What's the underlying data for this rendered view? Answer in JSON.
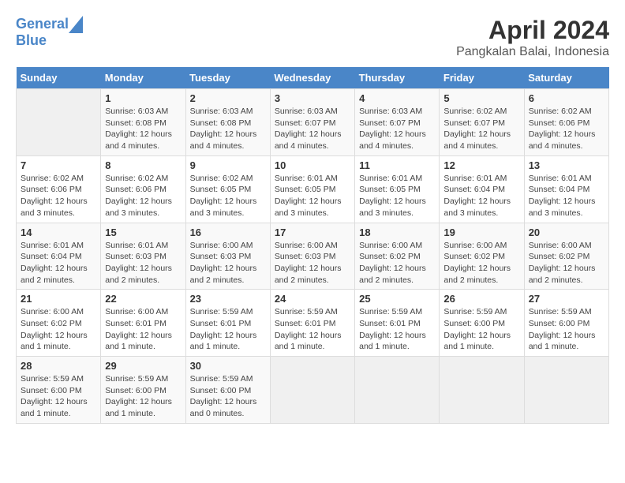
{
  "header": {
    "logo_line1": "General",
    "logo_line2": "Blue",
    "title": "April 2024",
    "subtitle": "Pangkalan Balai, Indonesia"
  },
  "weekdays": [
    "Sunday",
    "Monday",
    "Tuesday",
    "Wednesday",
    "Thursday",
    "Friday",
    "Saturday"
  ],
  "weeks": [
    [
      {
        "day": "",
        "info": ""
      },
      {
        "day": "1",
        "info": "Sunrise: 6:03 AM\nSunset: 6:08 PM\nDaylight: 12 hours\nand 4 minutes."
      },
      {
        "day": "2",
        "info": "Sunrise: 6:03 AM\nSunset: 6:08 PM\nDaylight: 12 hours\nand 4 minutes."
      },
      {
        "day": "3",
        "info": "Sunrise: 6:03 AM\nSunset: 6:07 PM\nDaylight: 12 hours\nand 4 minutes."
      },
      {
        "day": "4",
        "info": "Sunrise: 6:03 AM\nSunset: 6:07 PM\nDaylight: 12 hours\nand 4 minutes."
      },
      {
        "day": "5",
        "info": "Sunrise: 6:02 AM\nSunset: 6:07 PM\nDaylight: 12 hours\nand 4 minutes."
      },
      {
        "day": "6",
        "info": "Sunrise: 6:02 AM\nSunset: 6:06 PM\nDaylight: 12 hours\nand 4 minutes."
      }
    ],
    [
      {
        "day": "7",
        "info": "Sunrise: 6:02 AM\nSunset: 6:06 PM\nDaylight: 12 hours\nand 3 minutes."
      },
      {
        "day": "8",
        "info": "Sunrise: 6:02 AM\nSunset: 6:06 PM\nDaylight: 12 hours\nand 3 minutes."
      },
      {
        "day": "9",
        "info": "Sunrise: 6:02 AM\nSunset: 6:05 PM\nDaylight: 12 hours\nand 3 minutes."
      },
      {
        "day": "10",
        "info": "Sunrise: 6:01 AM\nSunset: 6:05 PM\nDaylight: 12 hours\nand 3 minutes."
      },
      {
        "day": "11",
        "info": "Sunrise: 6:01 AM\nSunset: 6:05 PM\nDaylight: 12 hours\nand 3 minutes."
      },
      {
        "day": "12",
        "info": "Sunrise: 6:01 AM\nSunset: 6:04 PM\nDaylight: 12 hours\nand 3 minutes."
      },
      {
        "day": "13",
        "info": "Sunrise: 6:01 AM\nSunset: 6:04 PM\nDaylight: 12 hours\nand 3 minutes."
      }
    ],
    [
      {
        "day": "14",
        "info": "Sunrise: 6:01 AM\nSunset: 6:04 PM\nDaylight: 12 hours\nand 2 minutes."
      },
      {
        "day": "15",
        "info": "Sunrise: 6:01 AM\nSunset: 6:03 PM\nDaylight: 12 hours\nand 2 minutes."
      },
      {
        "day": "16",
        "info": "Sunrise: 6:00 AM\nSunset: 6:03 PM\nDaylight: 12 hours\nand 2 minutes."
      },
      {
        "day": "17",
        "info": "Sunrise: 6:00 AM\nSunset: 6:03 PM\nDaylight: 12 hours\nand 2 minutes."
      },
      {
        "day": "18",
        "info": "Sunrise: 6:00 AM\nSunset: 6:02 PM\nDaylight: 12 hours\nand 2 minutes."
      },
      {
        "day": "19",
        "info": "Sunrise: 6:00 AM\nSunset: 6:02 PM\nDaylight: 12 hours\nand 2 minutes."
      },
      {
        "day": "20",
        "info": "Sunrise: 6:00 AM\nSunset: 6:02 PM\nDaylight: 12 hours\nand 2 minutes."
      }
    ],
    [
      {
        "day": "21",
        "info": "Sunrise: 6:00 AM\nSunset: 6:02 PM\nDaylight: 12 hours\nand 1 minute."
      },
      {
        "day": "22",
        "info": "Sunrise: 6:00 AM\nSunset: 6:01 PM\nDaylight: 12 hours\nand 1 minute."
      },
      {
        "day": "23",
        "info": "Sunrise: 5:59 AM\nSunset: 6:01 PM\nDaylight: 12 hours\nand 1 minute."
      },
      {
        "day": "24",
        "info": "Sunrise: 5:59 AM\nSunset: 6:01 PM\nDaylight: 12 hours\nand 1 minute."
      },
      {
        "day": "25",
        "info": "Sunrise: 5:59 AM\nSunset: 6:01 PM\nDaylight: 12 hours\nand 1 minute."
      },
      {
        "day": "26",
        "info": "Sunrise: 5:59 AM\nSunset: 6:00 PM\nDaylight: 12 hours\nand 1 minute."
      },
      {
        "day": "27",
        "info": "Sunrise: 5:59 AM\nSunset: 6:00 PM\nDaylight: 12 hours\nand 1 minute."
      }
    ],
    [
      {
        "day": "28",
        "info": "Sunrise: 5:59 AM\nSunset: 6:00 PM\nDaylight: 12 hours\nand 1 minute."
      },
      {
        "day": "29",
        "info": "Sunrise: 5:59 AM\nSunset: 6:00 PM\nDaylight: 12 hours\nand 1 minute."
      },
      {
        "day": "30",
        "info": "Sunrise: 5:59 AM\nSunset: 6:00 PM\nDaylight: 12 hours\nand 0 minutes."
      },
      {
        "day": "",
        "info": ""
      },
      {
        "day": "",
        "info": ""
      },
      {
        "day": "",
        "info": ""
      },
      {
        "day": "",
        "info": ""
      }
    ]
  ]
}
